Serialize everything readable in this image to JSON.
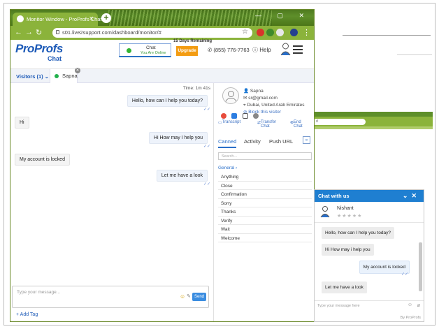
{
  "browser": {
    "tab_title": "Monitor Window - ProProfs Chat",
    "url": "s01.live2support.com/dashboard/monitor/#",
    "window_controls": "— ▢ ✕"
  },
  "header": {
    "logo_main": "ProProfs",
    "logo_sub": "Chat",
    "chat_status_title": "Chat",
    "chat_status_sub": "You Are Online",
    "remaining": "15 Days Remaining",
    "upgrade_label": "Upgrade",
    "phone": "(855) 776-7763",
    "help_label": "Help"
  },
  "tabs": {
    "visitors_label": "Visitors (1)",
    "visitor_tab": "Sapna"
  },
  "conversation": {
    "timer": "Time: 1m 41s",
    "messages": [
      "Hello, how can I help you today?",
      "Hi",
      "Hi How may I help you",
      "My account is locked",
      "Let me have a look"
    ],
    "input_placeholder": "Type your message...",
    "send_label": "Send",
    "add_tag": "+ Add Tag"
  },
  "visitor": {
    "name": "Sapna",
    "email": "sr@gmail.com",
    "location": "Dubai, United Arab Emirates",
    "block": "Block this visitor",
    "actions": [
      "Transcript",
      "Transfer Chat",
      "End Chat"
    ]
  },
  "panel": {
    "tabs": [
      "Canned",
      "Activity",
      "Push URL"
    ],
    "search_placeholder": "Search...",
    "group": "General",
    "canned": [
      "Anything",
      "Close",
      "Confirmation",
      "Sorry",
      "Thanks",
      "Verify",
      "Wait",
      "Welcome"
    ]
  },
  "widget": {
    "title": "Chat with us",
    "agent_name": "Nishant",
    "stars": "★★★★★",
    "messages": [
      "Hello, how can I help you today?",
      "Hi How may i help you",
      "My account is locked",
      "Let me have a look"
    ],
    "placeholder": "Type your message here",
    "brand": "By ProProfs"
  },
  "colors": {
    "accent": "#1e5bb8",
    "online": "#33b533",
    "upgrade": "#f39c12",
    "widget_header": "#1f7fd1"
  }
}
